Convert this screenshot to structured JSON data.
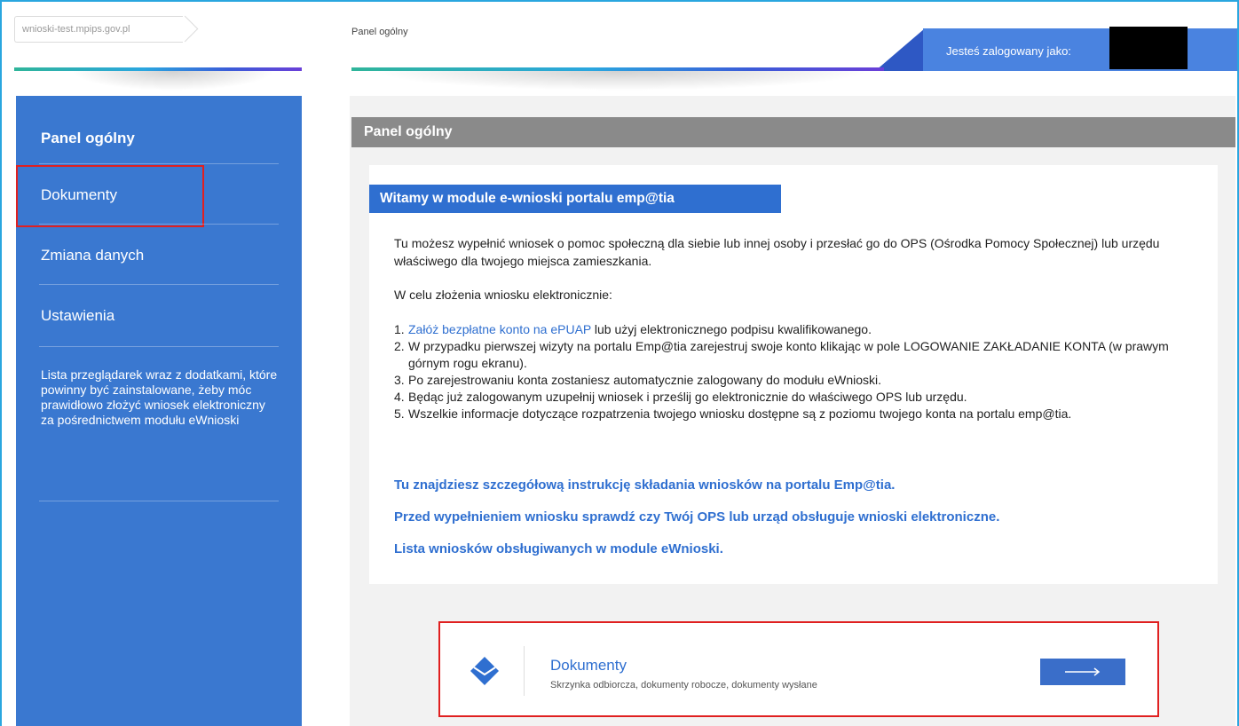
{
  "breadcrumb": {
    "host": "wnioski-test.mpips.gov.pl"
  },
  "header": {
    "page_title": "Panel ogólny",
    "login_text": "Jesteś zalogowany jako:"
  },
  "sidebar": {
    "items": [
      {
        "label": "Panel ogólny"
      },
      {
        "label": "Dokumenty"
      },
      {
        "label": "Zmiana danych"
      },
      {
        "label": "Ustawienia"
      },
      {
        "label": "Lista przeglądarek wraz z dodatkami, które powinny być zainstalowane, żeby móc prawidłowo złożyć wniosek elektroniczny za pośrednictwem modułu eWnioski"
      }
    ]
  },
  "main": {
    "panel_title": "Panel ogólny",
    "welcome": "Witamy w module e-wnioski portalu emp@tia",
    "intro": "Tu możesz wypełnić wniosek o pomoc społeczną dla siebie lub innej osoby i przesłać go do OPS (Ośrodka Pomocy Społecznej) lub urzędu właściwego dla twojego miejsca zamieszkania.",
    "steps_heading": "W celu złożenia wniosku elektronicznie:",
    "steps": [
      {
        "num": "1.",
        "link": "Załóż bezpłatne konto na ePUAP",
        "text": " lub użyj elektronicznego podpisu kwalifikowanego."
      },
      {
        "num": "2.",
        "text": "W przypadku pierwszej wizyty na portalu Emp@tia zarejestruj swoje konto klikając w pole LOGOWANIE ZAKŁADANIE KONTA (w prawym górnym rogu ekranu)."
      },
      {
        "num": "3.",
        "text": "Po zarejestrowaniu konta zostaniesz automatycznie zalogowany do modułu eWnioski."
      },
      {
        "num": "4.",
        "text": "Będąc już zalogowanym uzupełnij wniosek i prześlij go elektronicznie do właściwego OPS lub urzędu."
      },
      {
        "num": "5.",
        "text": "Wszelkie informacje dotyczące rozpatrzenia twojego wniosku dostępne są z poziomu twojego konta na portalu emp@tia."
      }
    ],
    "links": [
      "Tu znajdziesz szczegółową instrukcję składania wniosków na portalu Emp@tia.",
      "Przed wypełnieniem wniosku sprawdź czy Twój OPS lub urząd obsługuje wnioski elektroniczne.",
      "Lista wniosków obsługiwanych w module eWnioski."
    ]
  },
  "documents_card": {
    "title": "Dokumenty",
    "subtitle": "Skrzynka odbiorcza, dokumenty robocze, dokumenty wysłane",
    "icon": "envelope-icon",
    "button_icon": "arrow-right-icon"
  },
  "colors": {
    "sidebar": "#3a78d0",
    "accent": "#2f6fd0",
    "panel_bar": "#8a8a8a",
    "highlight": "#e02020"
  }
}
